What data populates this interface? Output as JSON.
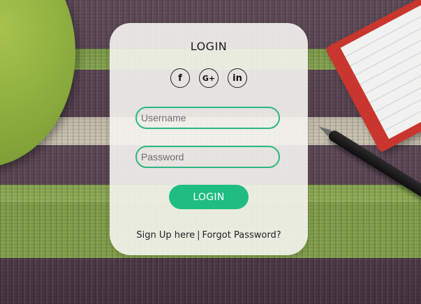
{
  "login_card": {
    "title": "LOGIN",
    "social": [
      {
        "icon": "facebook-icon",
        "glyph": "f"
      },
      {
        "icon": "google-plus-icon",
        "glyph": "G+"
      },
      {
        "icon": "linkedin-icon",
        "glyph": "in"
      }
    ],
    "username_placeholder": "Username",
    "password_placeholder": "Password",
    "submit_label": "LOGIN",
    "signup_link": "Sign Up here",
    "separator": "|",
    "forgot_link": "Forgot Password?"
  },
  "colors": {
    "accent": "#1fbd81",
    "input_border": "#2bb781",
    "card_background": "#f5f4f0"
  }
}
